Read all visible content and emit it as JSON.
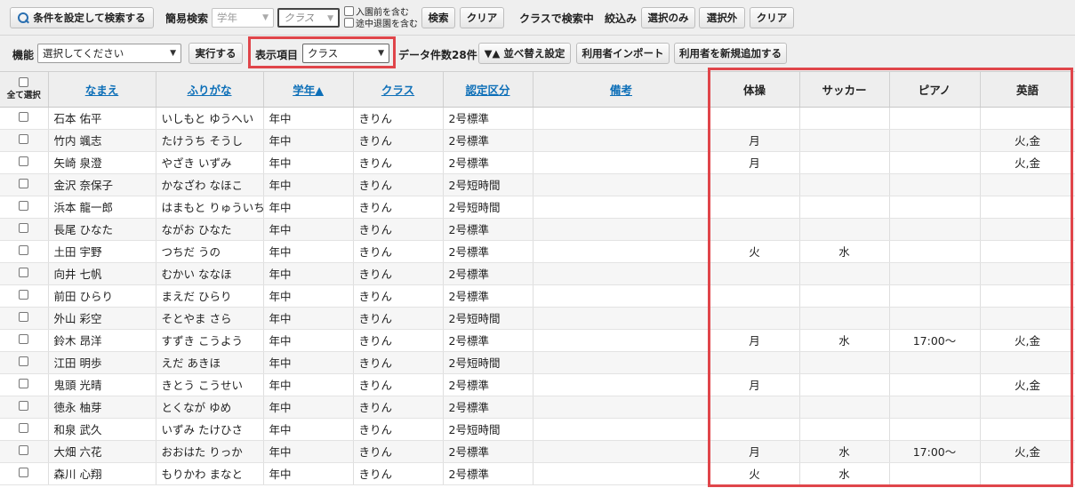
{
  "toolbar1": {
    "cond_search_label": "条件を設定して検索する",
    "simple_search_label": "簡易検索",
    "grade_select": "学年",
    "class_select": "クラス",
    "include_pre_entry": "入園前を含む",
    "include_withdrawn": "途中退園を含む",
    "search_label": "検索",
    "clear_label": "クリア",
    "class_search_status": "クラスで検索中",
    "filter_label": "絞込み",
    "selected_only_label": "選択のみ",
    "excluded_label": "選択外",
    "clear2_label": "クリア"
  },
  "toolbar2": {
    "function_label": "機能",
    "function_select": "選択してください",
    "execute_label": "実行する",
    "display_items_label": "表示項目",
    "display_items_select": "クラス",
    "data_count": "データ件数28件",
    "sort_settings_label": "▼▲ 並べ替え設定",
    "import_label": "利用者インポート",
    "add_user_label": "利用者を新規追加する"
  },
  "table": {
    "select_all_label": "全て選択",
    "headers": {
      "name": "なまえ",
      "kana": "ふりがな",
      "grade": "学年▲",
      "class": "クラス",
      "cert": "認定区分",
      "note": "備考",
      "gym": "体操",
      "soccer": "サッカー",
      "piano": "ピアノ",
      "english": "英語"
    },
    "rows": [
      {
        "name": "石本 佑平",
        "kana": "いしもと ゆうへい",
        "grade": "年中",
        "class": "きりん",
        "cert": "2号標準",
        "note": "",
        "gym": "",
        "soccer": "",
        "piano": "",
        "english": ""
      },
      {
        "name": "竹内 颯志",
        "kana": "たけうち そうし",
        "grade": "年中",
        "class": "きりん",
        "cert": "2号標準",
        "note": "",
        "gym": "月",
        "soccer": "",
        "piano": "",
        "english": "火,金"
      },
      {
        "name": "矢崎 泉澄",
        "kana": "やざき いずみ",
        "grade": "年中",
        "class": "きりん",
        "cert": "2号標準",
        "note": "",
        "gym": "月",
        "soccer": "",
        "piano": "",
        "english": "火,金"
      },
      {
        "name": "金沢 奈保子",
        "kana": "かなざわ なほこ",
        "grade": "年中",
        "class": "きりん",
        "cert": "2号短時間",
        "note": "",
        "gym": "",
        "soccer": "",
        "piano": "",
        "english": ""
      },
      {
        "name": "浜本 龍一郎",
        "kana": "はまもと りゅういちろう",
        "grade": "年中",
        "class": "きりん",
        "cert": "2号短時間",
        "note": "",
        "gym": "",
        "soccer": "",
        "piano": "",
        "english": ""
      },
      {
        "name": "長尾 ひなた",
        "kana": "ながお ひなた",
        "grade": "年中",
        "class": "きりん",
        "cert": "2号標準",
        "note": "",
        "gym": "",
        "soccer": "",
        "piano": "",
        "english": ""
      },
      {
        "name": "土田 宇野",
        "kana": "つちだ うの",
        "grade": "年中",
        "class": "きりん",
        "cert": "2号標準",
        "note": "",
        "gym": "火",
        "soccer": "水",
        "piano": "",
        "english": ""
      },
      {
        "name": "向井 七帆",
        "kana": "むかい ななほ",
        "grade": "年中",
        "class": "きりん",
        "cert": "2号標準",
        "note": "",
        "gym": "",
        "soccer": "",
        "piano": "",
        "english": ""
      },
      {
        "name": "前田 ひらり",
        "kana": "まえだ ひらり",
        "grade": "年中",
        "class": "きりん",
        "cert": "2号標準",
        "note": "",
        "gym": "",
        "soccer": "",
        "piano": "",
        "english": ""
      },
      {
        "name": "外山 彩空",
        "kana": "そとやま さら",
        "grade": "年中",
        "class": "きりん",
        "cert": "2号短時間",
        "note": "",
        "gym": "",
        "soccer": "",
        "piano": "",
        "english": ""
      },
      {
        "name": "鈴木 昂洋",
        "kana": "すずき こうよう",
        "grade": "年中",
        "class": "きりん",
        "cert": "2号標準",
        "note": "",
        "gym": "月",
        "soccer": "水",
        "piano": "17:00～",
        "english": "火,金"
      },
      {
        "name": "江田 明歩",
        "kana": "えだ あきほ",
        "grade": "年中",
        "class": "きりん",
        "cert": "2号短時間",
        "note": "",
        "gym": "",
        "soccer": "",
        "piano": "",
        "english": ""
      },
      {
        "name": "鬼頭 光晴",
        "kana": "きとう こうせい",
        "grade": "年中",
        "class": "きりん",
        "cert": "2号標準",
        "note": "",
        "gym": "月",
        "soccer": "",
        "piano": "",
        "english": "火,金"
      },
      {
        "name": "徳永 柚芽",
        "kana": "とくなが ゆめ",
        "grade": "年中",
        "class": "きりん",
        "cert": "2号標準",
        "note": "",
        "gym": "",
        "soccer": "",
        "piano": "",
        "english": ""
      },
      {
        "name": "和泉 武久",
        "kana": "いずみ たけひさ",
        "grade": "年中",
        "class": "きりん",
        "cert": "2号短時間",
        "note": "",
        "gym": "",
        "soccer": "",
        "piano": "",
        "english": ""
      },
      {
        "name": "大畑 六花",
        "kana": "おおはた りっか",
        "grade": "年中",
        "class": "きりん",
        "cert": "2号標準",
        "note": "",
        "gym": "月",
        "soccer": "水",
        "piano": "17:00～",
        "english": "火,金"
      },
      {
        "name": "森川 心翔",
        "kana": "もりかわ まなと",
        "grade": "年中",
        "class": "きりん",
        "cert": "2号標準",
        "note": "",
        "gym": "火",
        "soccer": "水",
        "piano": "",
        "english": ""
      }
    ]
  },
  "colors": {
    "highlight_border": "#e0454a",
    "header_link": "#0d6fb8",
    "toolbar_bg": "#efefef"
  }
}
